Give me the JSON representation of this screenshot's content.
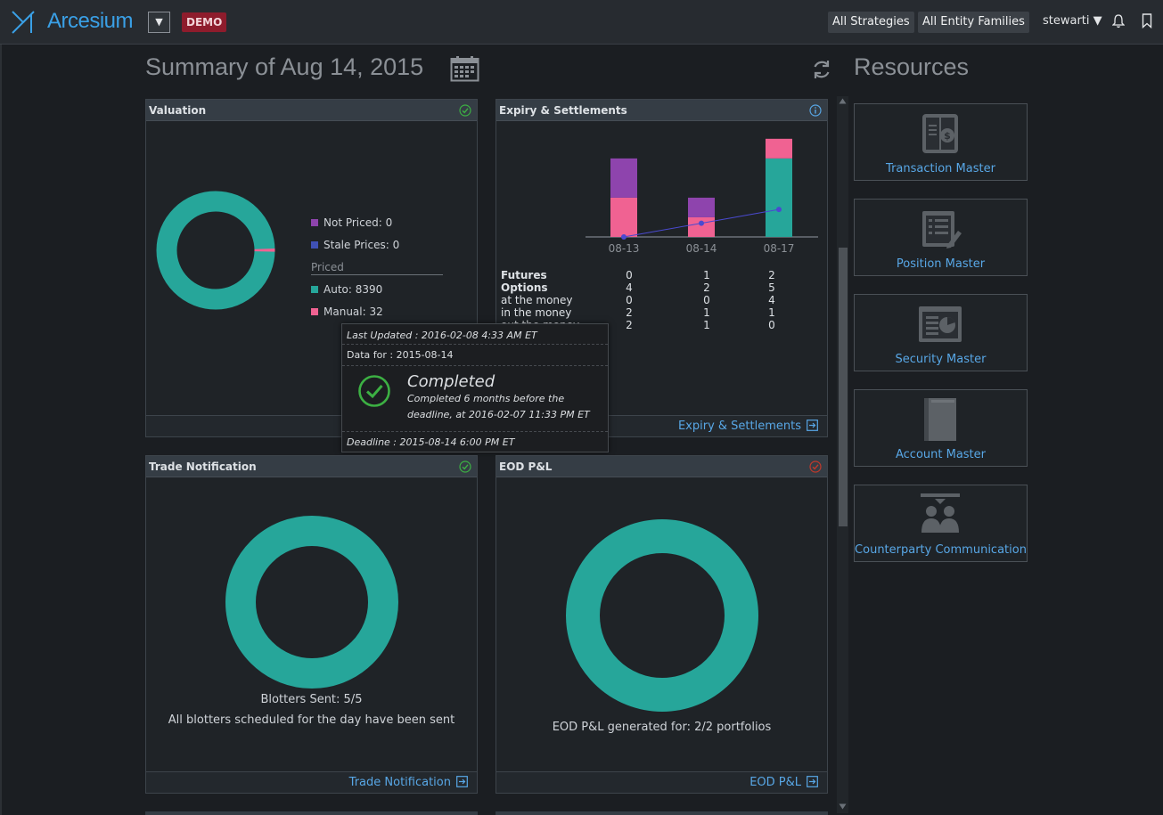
{
  "topbar": {
    "logo_text": "Arcesium",
    "demo_badge": "DEMO",
    "dropdown_glyph": "▼",
    "strategies_btn": "All Strategies",
    "entity_btn": "All Entity Families",
    "user": "stewarti ▼"
  },
  "summary": {
    "title": "Summary of Aug 14, 2015"
  },
  "resources": {
    "title": "Resources",
    "items": [
      {
        "label": "Transaction Master",
        "icon": "transaction-master-icon"
      },
      {
        "label": "Position Master",
        "icon": "position-master-icon"
      },
      {
        "label": "Security Master",
        "icon": "security-master-icon"
      },
      {
        "label": "Account Master",
        "icon": "account-master-icon"
      },
      {
        "label": "Counterparty Communication",
        "icon": "counterparty-icon"
      }
    ]
  },
  "valuation": {
    "title": "Valuation",
    "status": "ok",
    "legend": {
      "not_priced": "Not Priced: 0",
      "stale": "Stale Prices: 0",
      "priced_header": "Priced",
      "auto": "Auto: 8390",
      "manual": "Manual: 32"
    },
    "donut": {
      "auto": 8390,
      "manual": 32
    }
  },
  "expiry": {
    "title": "Expiry & Settlements",
    "footer_link": "Expiry & Settlements",
    "rows": [
      {
        "label": "Futures",
        "bold": true,
        "values": [
          "0",
          "1",
          "2"
        ]
      },
      {
        "label": "Options",
        "bold": true,
        "values": [
          "4",
          "2",
          "5"
        ]
      },
      {
        "label": "at the money",
        "bold": false,
        "values": [
          "0",
          "0",
          "4"
        ]
      },
      {
        "label": "in the money",
        "bold": false,
        "values": [
          "2",
          "1",
          "1"
        ]
      },
      {
        "label": "out the money",
        "bold": false,
        "values": [
          "2",
          "1",
          "0"
        ]
      }
    ]
  },
  "chart_data": {
    "type": "bar",
    "categories": [
      "08-13",
      "08-14",
      "08-17"
    ],
    "series": [
      {
        "values": [
          0,
          0,
          4
        ],
        "color": "#26a69a"
      },
      {
        "values": [
          2,
          1,
          1
        ],
        "color": "#f06292"
      },
      {
        "values": [
          2,
          1,
          0
        ],
        "color": "#8e44ad"
      }
    ],
    "line_values": [
      0,
      1,
      2
    ],
    "line_color": "#4a4ad0",
    "ylim": [
      0,
      5.4
    ],
    "grid": false
  },
  "tooltip": {
    "last_updated": "Last Updated : 2016-02-08 4:33 AM ET",
    "data_for": "Data for : 2015-08-14",
    "status": "Completed",
    "detail1": "Completed 6 months before the",
    "detail2": "deadline, at 2016-02-07 11:33 PM ET",
    "deadline": "Deadline : 2015-08-14 6:00 PM ET"
  },
  "trade": {
    "title": "Trade Notification",
    "status": "ok",
    "line1": "Blotters Sent: 5/5",
    "line2": "All blotters scheduled for the day have been sent",
    "footer_link": "Trade Notification"
  },
  "eod": {
    "title": "EOD P&L",
    "status": "warning",
    "line1": "EOD P&L generated for: 2/2 portfolios",
    "footer_link": "EOD P&L"
  },
  "colors": {
    "teal": "#26a69a",
    "pink": "#f06292",
    "purple": "#8e44ad",
    "blue_legend": "#3f51b5",
    "link": "#58a7e6",
    "ok": "#3cb043",
    "warn": "#c0392b"
  }
}
